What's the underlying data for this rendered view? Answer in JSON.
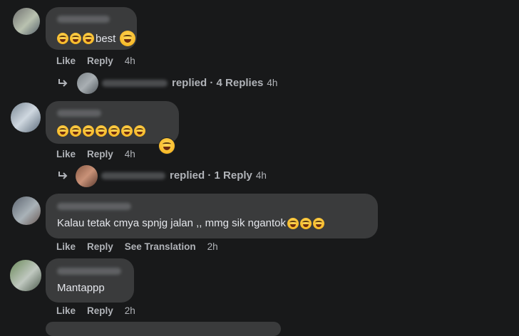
{
  "comments": [
    {
      "text_suffix": "best",
      "emoji_count": 3,
      "trailing_emoji": "laughing-face",
      "actions": {
        "like": "Like",
        "reply": "Reply",
        "time": "4h"
      },
      "replies": {
        "label": "replied · 4 Replies",
        "time": "4h"
      }
    },
    {
      "emoji_count": 7,
      "reaction_emoji": "laughing-face",
      "actions": {
        "like": "Like",
        "reply": "Reply",
        "time": "4h"
      },
      "replies": {
        "label": "replied · 1 Reply",
        "time": "4h"
      }
    },
    {
      "text": "Kalau tetak cmya spnjg jalan ,, mmg sik ngantok",
      "trailing_emoji_count": 3,
      "actions": {
        "like": "Like",
        "reply": "Reply",
        "translate": "See Translation",
        "time": "2h"
      }
    },
    {
      "text": "Mantappp",
      "actions": {
        "like": "Like",
        "reply": "Reply",
        "time": "2h"
      }
    }
  ]
}
